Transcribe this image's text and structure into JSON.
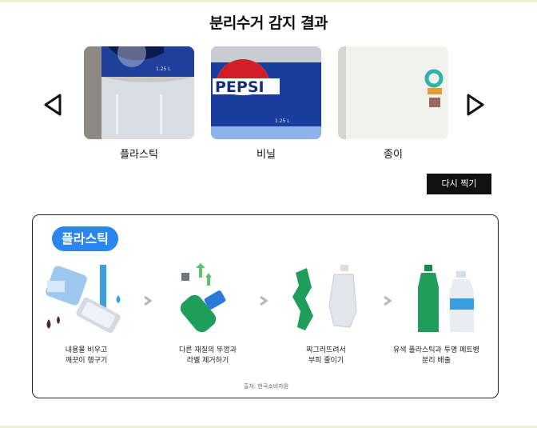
{
  "page_title": "분리수거 감지 결과",
  "carousel": {
    "items": [
      {
        "label": "플라스틱",
        "image": "pepsi-bottle-clear"
      },
      {
        "label": "비닐",
        "image": "pepsi-bottle-label"
      },
      {
        "label": "종이",
        "image": "paper-cup"
      }
    ],
    "prev_icon": "chevron-left-icon",
    "next_icon": "chevron-right-icon"
  },
  "retake_button": "다시 찍기",
  "result_card": {
    "badge": "플라스틱",
    "badge_color": "#2b86f0",
    "steps": [
      {
        "line1": "내용물 비우고",
        "line2": "깨끗이 헹구기",
        "icon": "rinse-bottle-icon"
      },
      {
        "line1": "다른 재질의 뚜껑과",
        "line2": "라벨 제거하기",
        "icon": "remove-cap-label-icon"
      },
      {
        "line1": "찌그러뜨려서",
        "line2": "부피 줄이기",
        "icon": "crush-bottle-icon"
      },
      {
        "line1": "유색 플라스틱과 투명 페트병",
        "line2": "분리 배출",
        "icon": "separate-bottles-icon"
      }
    ],
    "source": "출처: 한국소비자원"
  }
}
